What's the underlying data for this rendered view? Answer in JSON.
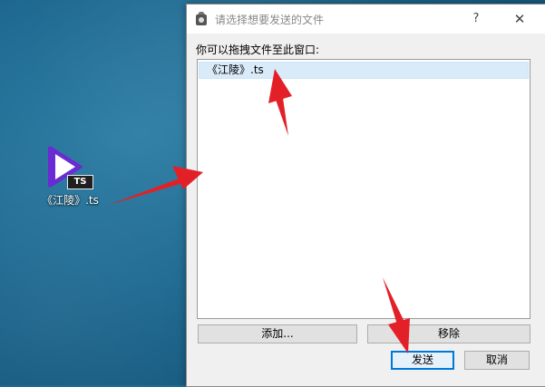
{
  "desktop": {
    "file_label": "《江陵》.ts",
    "badge": "TS"
  },
  "dialog": {
    "title": "请选择想要发送的文件",
    "help": "?",
    "close": "✕",
    "prompt": "你可以拖拽文件至此窗口:",
    "files": [
      {
        "name": "《江陵》.ts"
      }
    ],
    "buttons": {
      "add": "添加...",
      "remove": "移除",
      "send": "发送",
      "cancel": "取消"
    }
  },
  "colors": {
    "arrow": "#e32027",
    "selection": "#d9ebf9",
    "accent": "#0078d7"
  }
}
